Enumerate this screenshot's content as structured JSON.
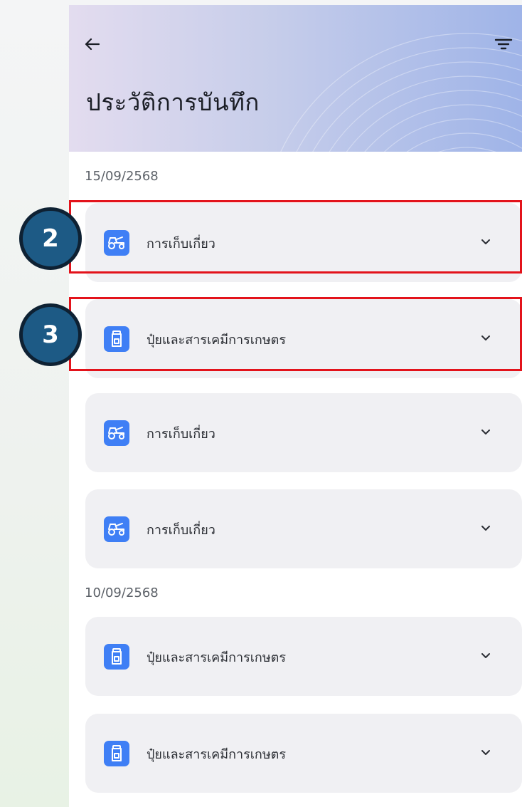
{
  "header": {
    "title": "ประวัติการบันทึก",
    "back_icon": "arrow-left-icon",
    "filter_icon": "filter-icon"
  },
  "groups": [
    {
      "date": "15/09/2568",
      "records": [
        {
          "label": "การเก็บเกี่ยว",
          "icon": "harvester-icon"
        },
        {
          "label": "ปุ๋ยและสารเคมีการเกษตร",
          "icon": "fertilizer-bottle-icon"
        },
        {
          "label": "การเก็บเกี่ยว",
          "icon": "harvester-icon"
        },
        {
          "label": "การเก็บเกี่ยว",
          "icon": "harvester-icon"
        }
      ]
    },
    {
      "date": "10/09/2568",
      "records": [
        {
          "label": "ปุ๋ยและสารเคมีการเกษตร",
          "icon": "fertilizer-bottle-icon"
        },
        {
          "label": "ปุ๋ยและสารเคมีการเกษตร",
          "icon": "fertilizer-bottle-icon"
        }
      ]
    }
  ],
  "annotations": [
    {
      "number": "2"
    },
    {
      "number": "3"
    }
  ],
  "colors": {
    "accent": "#3f7ff5",
    "card": "#f0f0f3",
    "highlight": "#e3131b",
    "badge": "#1d5a85"
  }
}
